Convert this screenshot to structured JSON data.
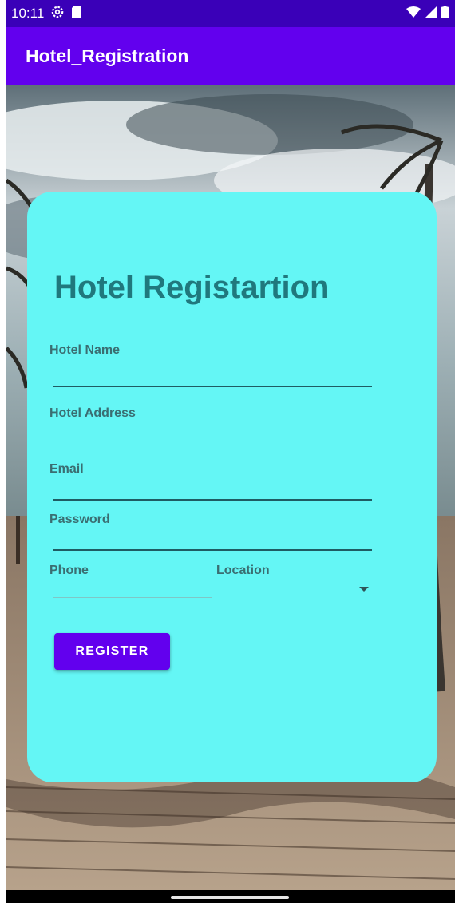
{
  "status_bar": {
    "time": "10:11",
    "icons_left": [
      "settings-gear-icon",
      "sd-card-icon"
    ],
    "icons_right": [
      "wifi-icon",
      "signal-icon",
      "battery-icon"
    ]
  },
  "app_bar": {
    "title": "Hotel_Registration"
  },
  "form": {
    "heading": "Hotel Registartion",
    "fields": {
      "hotel_name": {
        "label": "Hotel Name",
        "value": ""
      },
      "hotel_address": {
        "label": "Hotel Address",
        "value": ""
      },
      "email": {
        "label": "Email",
        "value": ""
      },
      "password": {
        "label": "Password",
        "value": ""
      },
      "phone": {
        "label": "Phone",
        "value": ""
      },
      "location": {
        "label": "Location",
        "selected": ""
      }
    },
    "register_label": "REGISTER"
  },
  "colors": {
    "status_bar": "#3a00b8",
    "app_bar": "#6200ee",
    "card": "#64f6f5",
    "heading": "#20787d",
    "button": "#6200ee"
  }
}
